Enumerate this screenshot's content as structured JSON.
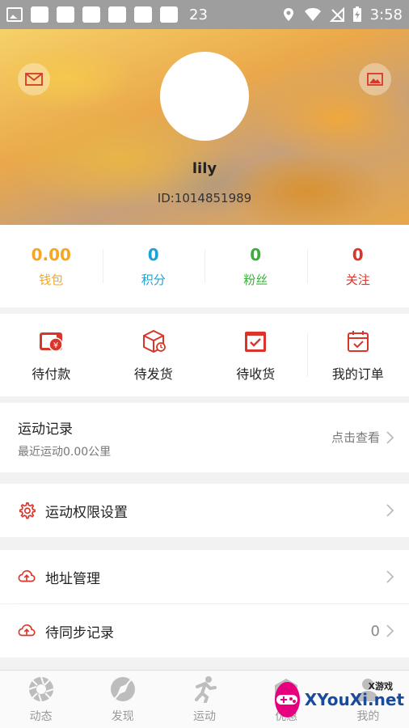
{
  "status_bar": {
    "notification_count": "23",
    "time": "3:58"
  },
  "profile": {
    "username": "lily",
    "user_id": "ID:1014851989"
  },
  "stats": [
    {
      "value": "0.00",
      "label": "钱包",
      "color": "#f5a623"
    },
    {
      "value": "0",
      "label": "积分",
      "color": "#1aa3d6"
    },
    {
      "value": "0",
      "label": "粉丝",
      "color": "#3cae3c"
    },
    {
      "value": "0",
      "label": "关注",
      "color": "#d9362b"
    }
  ],
  "orders": [
    {
      "label": "待付款",
      "icon": "wallet-yuan-icon"
    },
    {
      "label": "待发货",
      "icon": "package-icon"
    },
    {
      "label": "待收货",
      "icon": "box-check-icon"
    },
    {
      "label": "我的订单",
      "icon": "calendar-check-icon"
    }
  ],
  "sport_record": {
    "title": "运动记录",
    "subtitle": "最近运动0.00公里",
    "link": "点击查看"
  },
  "menu": {
    "permission_settings": {
      "label": "运动权限设置",
      "icon": "gear-icon"
    },
    "address": {
      "label": "地址管理",
      "icon": "cloud-upload-icon"
    },
    "pending_sync": {
      "label": "待同步记录",
      "icon": "cloud-upload-icon",
      "count": "0"
    }
  },
  "bottom_nav": [
    {
      "label": "动态",
      "icon": "aperture-icon"
    },
    {
      "label": "发现",
      "icon": "compass-icon"
    },
    {
      "label": "运动",
      "icon": "running-icon"
    },
    {
      "label": "优惠",
      "icon": "gift-icon"
    },
    {
      "label": "我的",
      "icon": "user-icon"
    }
  ],
  "watermark": {
    "text": "XYouXi.net",
    "small": "X游戏"
  },
  "colors": {
    "accent_red": "#d9362b",
    "status_bar": "#9e9e9e"
  }
}
